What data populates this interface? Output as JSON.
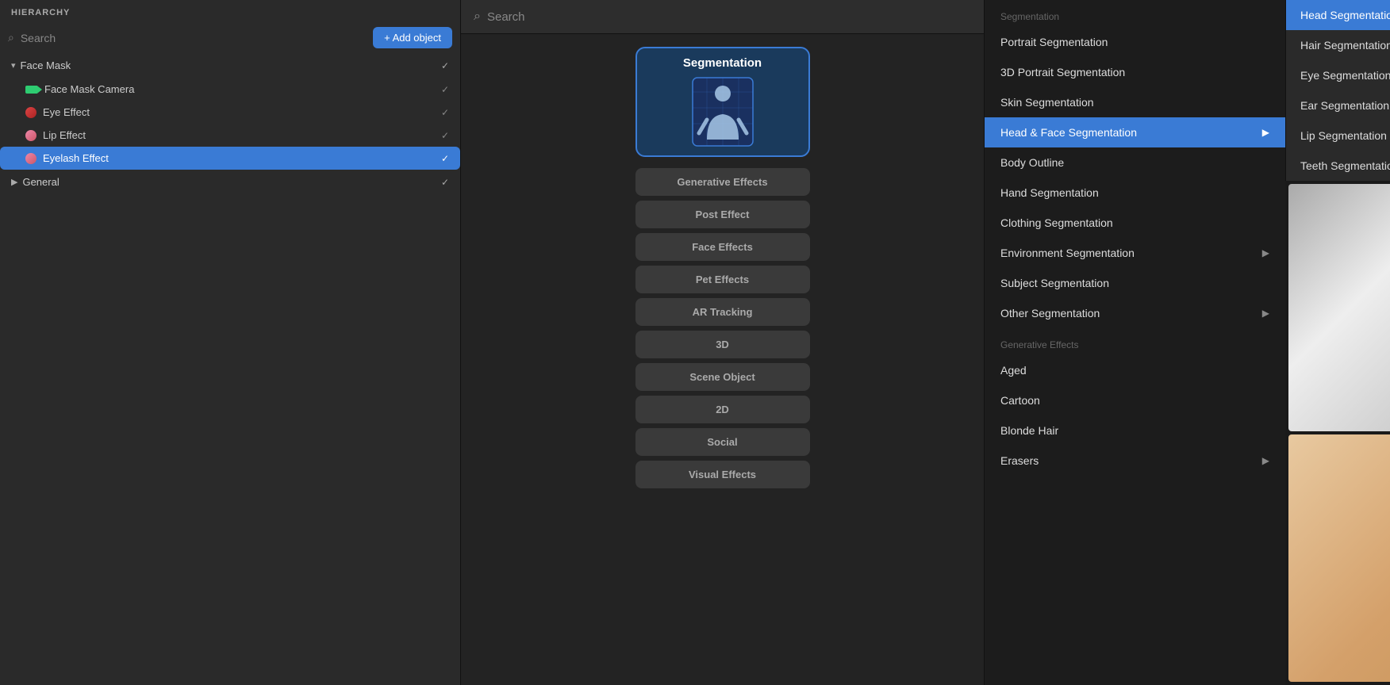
{
  "hierarchy": {
    "title": "HIERARCHY",
    "search_placeholder": "Search",
    "add_button": "+ Add object",
    "items": [
      {
        "label": "Face Mask",
        "type": "parent",
        "expanded": true,
        "checked": true,
        "children": [
          {
            "label": "Face Mask Camera",
            "icon": "camera",
            "checked": true
          },
          {
            "label": "Eye Effect",
            "icon": "eye",
            "checked": true
          },
          {
            "label": "Lip Effect",
            "icon": "lip",
            "checked": true
          },
          {
            "label": "Eyelash Effect",
            "icon": "eyelash",
            "checked": true,
            "selected": true
          }
        ]
      },
      {
        "label": "General",
        "type": "parent",
        "expanded": false,
        "checked": true,
        "children": []
      }
    ]
  },
  "center": {
    "search_placeholder": "Search",
    "featured_card": {
      "title": "Segmentation",
      "icon_alt": "segmentation icon"
    },
    "categories": [
      "Generative Effects",
      "Post Effect",
      "Face Effects",
      "Pet Effects",
      "AR Tracking",
      "3D",
      "Scene Object",
      "2D",
      "Social",
      "Visual Effects"
    ]
  },
  "seg_menu": {
    "section_segmentation": "Segmentation",
    "items": [
      {
        "label": "Portrait Segmentation",
        "has_arrow": false
      },
      {
        "label": "3D Portrait Segmentation",
        "has_arrow": false
      },
      {
        "label": "Skin Segmentation",
        "has_arrow": false
      },
      {
        "label": "Head & Face Segmentation",
        "has_arrow": true,
        "highlighted": true
      },
      {
        "label": "Body Outline",
        "has_arrow": false
      },
      {
        "label": "Hand Segmentation",
        "has_arrow": false
      },
      {
        "label": "Clothing Segmentation",
        "has_arrow": false
      },
      {
        "label": "Environment Segmentation",
        "has_arrow": true
      },
      {
        "label": "Subject Segmentation",
        "has_arrow": false
      },
      {
        "label": "Other Segmentation",
        "has_arrow": true
      }
    ],
    "section_generative": "Generative Effects",
    "generative_items": [
      {
        "label": "Aged",
        "has_arrow": false
      },
      {
        "label": "Cartoon",
        "has_arrow": false
      },
      {
        "label": "Blonde Hair",
        "has_arrow": false
      },
      {
        "label": "Erasers",
        "has_arrow": true
      }
    ]
  },
  "sub_menu": {
    "items": [
      {
        "label": "Head Segmentation",
        "selected": true
      },
      {
        "label": "Hair Segmentation",
        "selected": false
      },
      {
        "label": "Eye Segmentation",
        "selected": false
      },
      {
        "label": "Ear Segmentation",
        "selected": false
      },
      {
        "label": "Lip Segmentation",
        "selected": false
      },
      {
        "label": "Teeth Segmentation",
        "selected": false
      }
    ]
  },
  "icons": {
    "search": "🔍",
    "chevron_right": "▶",
    "chevron_down": "▼",
    "check": "✓",
    "plus": "+",
    "info": "i",
    "drag": "✋"
  }
}
